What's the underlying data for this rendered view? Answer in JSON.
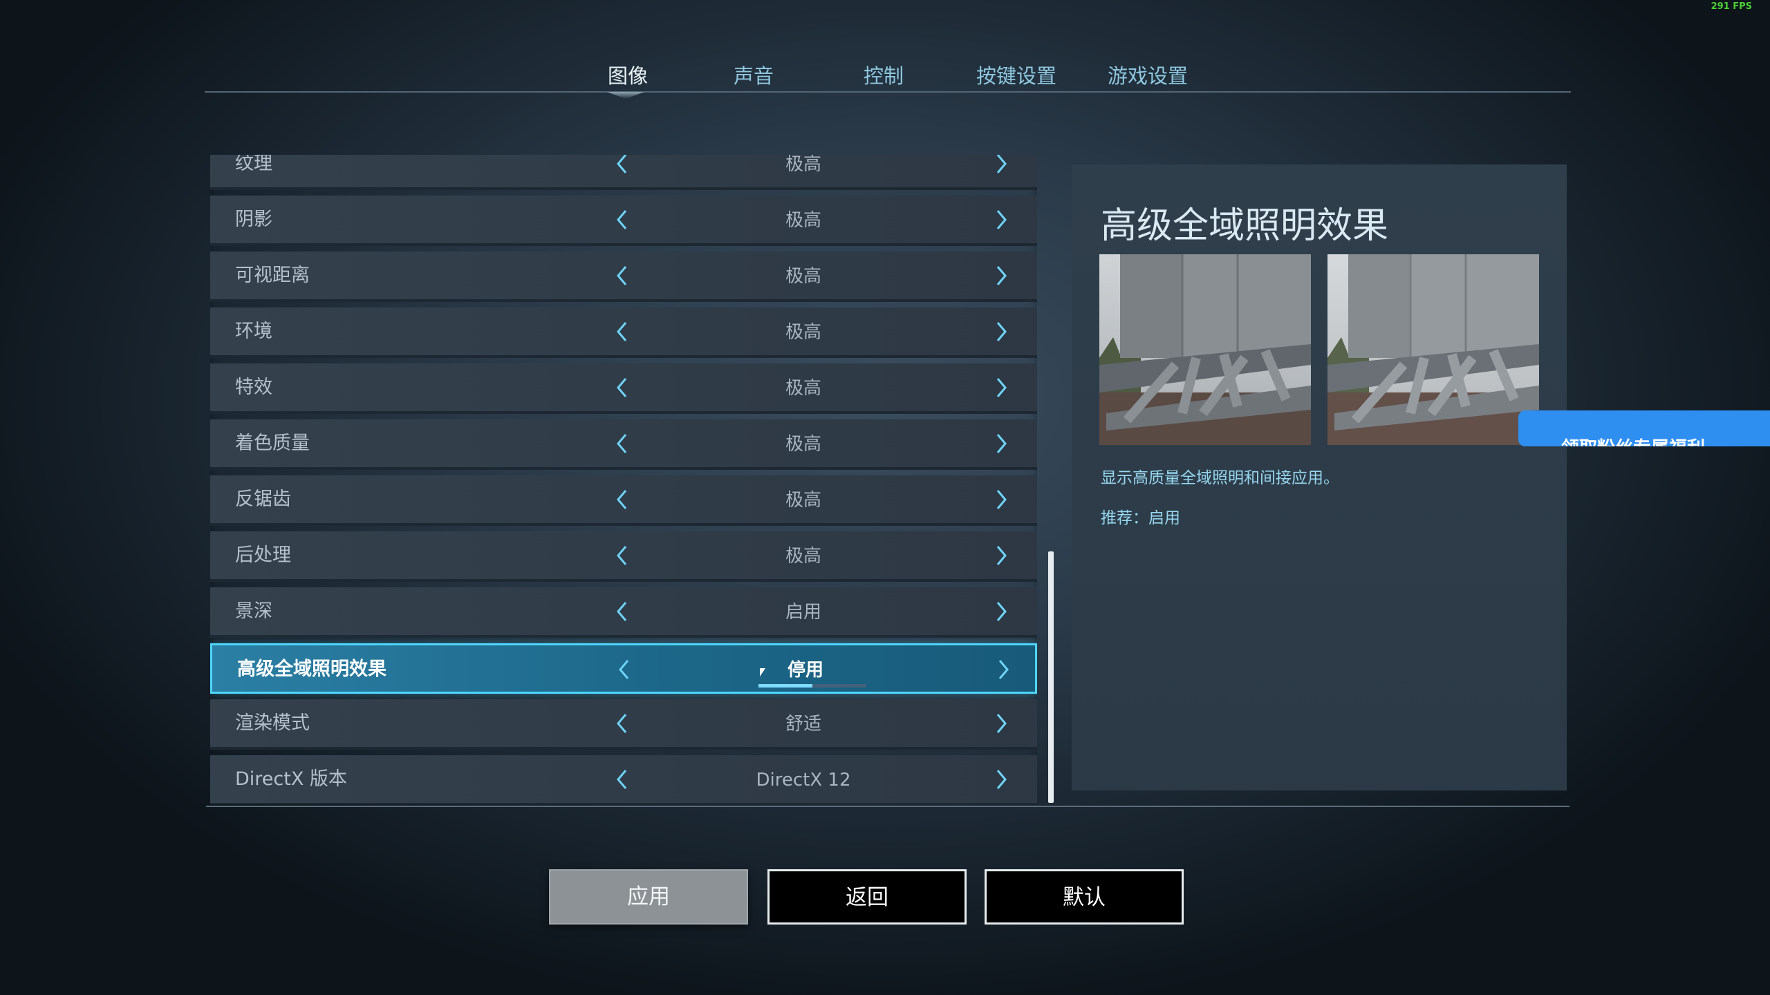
{
  "hud": {
    "fps": "291 FPS"
  },
  "tabs": [
    {
      "label": "图像",
      "active": true
    },
    {
      "label": "声音",
      "active": false
    },
    {
      "label": "控制",
      "active": false
    },
    {
      "label": "按键设置",
      "active": false
    },
    {
      "label": "游戏设置",
      "active": false
    }
  ],
  "settings": [
    {
      "label": "纹理",
      "value": "极高"
    },
    {
      "label": "阴影",
      "value": "极高"
    },
    {
      "label": "可视距离",
      "value": "极高"
    },
    {
      "label": "环境",
      "value": "极高"
    },
    {
      "label": "特效",
      "value": "极高"
    },
    {
      "label": "着色质量",
      "value": "极高"
    },
    {
      "label": "反锯齿",
      "value": "极高"
    },
    {
      "label": "后处理",
      "value": "极高"
    },
    {
      "label": "景深",
      "value": "启用"
    },
    {
      "label": "高级全域照明效果",
      "value": "停用",
      "selected": true,
      "progress": 0.5
    },
    {
      "label": "渲染模式",
      "value": "舒适"
    },
    {
      "label": "DirectX 版本",
      "value": "DirectX 12"
    }
  ],
  "detail": {
    "title": "高级全域照明效果",
    "description": "显示高质量全域照明和间接应用。",
    "recommendation": "推荐：启用"
  },
  "promo": {
    "label": "领取粉丝专属福利"
  },
  "buttons": {
    "apply": "应用",
    "back": "返回",
    "default": "默认"
  },
  "colors": {
    "accent": "#4fd6ff",
    "selected_row": "#1c6789",
    "promo": "#2f8ff0"
  },
  "icons": {
    "prev": "chevron-left-icon",
    "next": "chevron-right-icon"
  }
}
